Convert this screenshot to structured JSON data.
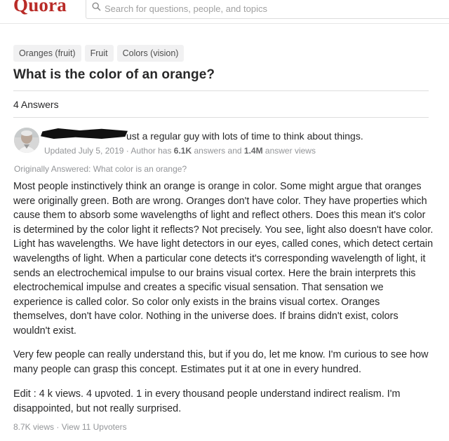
{
  "header": {
    "logo": "Quora",
    "search_placeholder": "Search for questions, people, and topics"
  },
  "question": {
    "topics": [
      "Oranges (fruit)",
      "Fruit",
      "Colors (vision)"
    ],
    "title": "What is the color of an orange?",
    "answers_count": "4 Answers"
  },
  "answer": {
    "author_bio": "ust a regular guy with lots of time to think about things.",
    "meta": {
      "updated": "Updated July 5, 2019 · Author has",
      "answers_num": "6.1K",
      "answers_label": "answers and",
      "views_num": "1.4M",
      "views_label": "answer views"
    },
    "originally_answered": "Originally Answered: What color is an orange?",
    "paragraphs": [
      "Most people instinctively think an orange is orange in color. Some might argue that oranges were originally green. Both are wrong. Oranges don't have color. They have properties which cause them to absorb some wavelengths of light and reflect others. Does this mean it's color is determined by the color light it reflects? Not precisely. You see, light also doesn't have color. Light has wavelengths. We have light detectors in our eyes, called cones, which detect certain wavelengths of light. When a particular cone detects it's corresponding wavelength of light, it sends an electrochemical impulse to our brains visual cortex. Here the brain interprets this electrochemical impulse and creates a specific visual sensation. That sensation we experience is called color. So color only exists in the brains visual cortex. Oranges themselves, don't have color. Nothing in the universe does. If brains didn't exist, colors wouldn't exist.",
      "Very few people can really understand this, but if you do, let me know. I'm curious to see how many people can grasp this concept. Estimates put it at one in every hundred.",
      "Edit : 4 k views. 4 upvoted. 1 in every thousand people understand indirect realism. I'm disappointed, but not really surprised."
    ],
    "footer": "8.7K views · View 11 Upvoters"
  },
  "colors": {
    "brand": "#b92b27",
    "text": "#282829",
    "muted": "#939598"
  },
  "icons": [
    "search-icon",
    "avatar",
    "redaction-mark"
  ]
}
